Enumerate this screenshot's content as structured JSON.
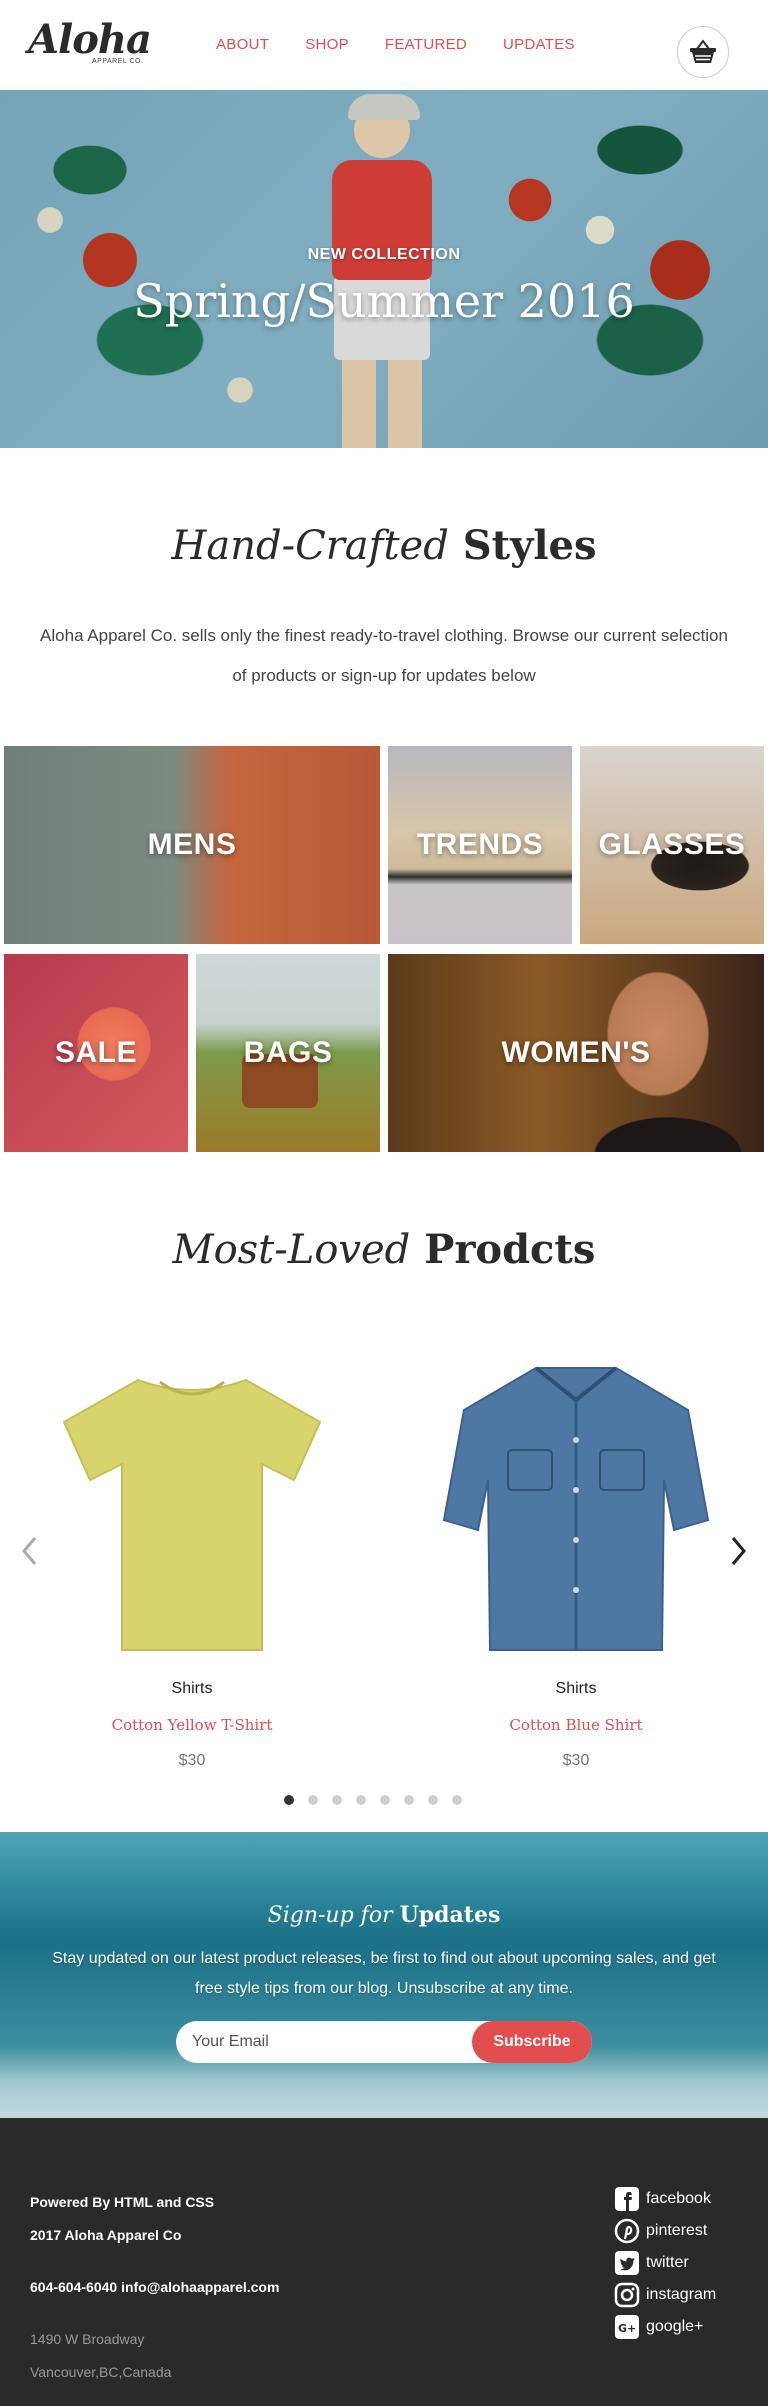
{
  "header": {
    "logo_text": "Aloha",
    "logo_sub": "APPAREL CO.",
    "nav": [
      {
        "label": "ABOUT"
      },
      {
        "label": "SHOP"
      },
      {
        "label": "FEATURED"
      },
      {
        "label": "UPDATES"
      }
    ],
    "cart_icon": "basket-icon"
  },
  "hero": {
    "subtitle": "NEW COLLECTION",
    "title": "Spring/Summer 2016"
  },
  "intro": {
    "title_italic": "Hand-Crafted",
    "title_bold": "Styles",
    "text": "Aloha Apparel Co. sells only the finest ready-to-travel clothing. Browse our current selection of products or sign-up for updates below"
  },
  "categories": [
    {
      "label": "MENS"
    },
    {
      "label": "TRENDS"
    },
    {
      "label": "GLASSES"
    },
    {
      "label": "SALE"
    },
    {
      "label": "BAGS"
    },
    {
      "label": "WOMEN'S"
    }
  ],
  "products_section": {
    "title_italic": "Most-Loved",
    "title_bold": "Prodcts",
    "prev_icon": "chevron-left-icon",
    "next_icon": "chevron-right-icon",
    "items": [
      {
        "category": "Shirts",
        "name": "Cotton Yellow T-Shirt",
        "price": "$30"
      },
      {
        "category": "Shirts",
        "name": "Cotton Blue Shirt",
        "price": "$30"
      }
    ],
    "pagination_count": 8,
    "pagination_active": 1
  },
  "signup": {
    "title_italic": "Sign-up for",
    "title_bold": "Updates",
    "text": "Stay updated on our latest product releases, be first to find out about upcoming sales, and get free style tips from our blog. Unsubscribe at any time.",
    "email_placeholder": "Your Email",
    "button_label": "Subscribe"
  },
  "footer": {
    "powered": "Powered By HTML and CSS",
    "copyright": "2017 Aloha Apparel Co",
    "contact": "604-604-6040 info@alohaapparel.com",
    "address_line1": "1490 W Broadway",
    "address_line2": "Vancouver,BC,Canada",
    "social": [
      {
        "label": "facebook",
        "icon": "facebook-icon"
      },
      {
        "label": "pinterest",
        "icon": "pinterest-icon"
      },
      {
        "label": "twitter",
        "icon": "twitter-icon"
      },
      {
        "label": "instagram",
        "icon": "instagram-icon"
      },
      {
        "label": "google+",
        "icon": "google-plus-icon"
      }
    ]
  },
  "colors": {
    "accent": "#e24d4d",
    "footer_bg": "#2a2a2a",
    "text_dark": "#2b2b2b"
  }
}
